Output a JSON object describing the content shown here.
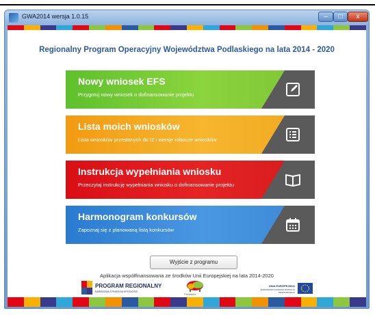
{
  "window": {
    "title": "GWA2014 wersja 1.0.15",
    "controls": {
      "minimize": "–",
      "maximize": "□",
      "close": "x"
    }
  },
  "colors": {
    "stripe": [
      "#e30613",
      "#f9b000",
      "#3a3a8c",
      "#2fa7d8",
      "#e30613",
      "#8dc63f",
      "#f39200",
      "#2c5aa0",
      "#8dc63f",
      "#e30613",
      "#3a3a8c",
      "#f9b000",
      "#2fa7d8",
      "#e30613",
      "#8dc63f",
      "#f39200",
      "#2c5aa0",
      "#e30613",
      "#f9b000",
      "#2fa7d8",
      "#8dc63f",
      "#3a3a8c"
    ],
    "heading": "#2c5aa0",
    "tile_green": "#6ec630",
    "tile_orange": "#f5a623",
    "tile_red": "#e01b1b",
    "tile_blue": "#3a8ad8"
  },
  "heading": "Regionalny Program Operacyjny Województwa Podlaskiego na lata 2014 - 2020",
  "tiles": [
    {
      "title": "Nowy wniosek EFS",
      "subtitle": "Przygotuj nowy wniosek o dofinansowanie projektu",
      "icon": "edit-icon"
    },
    {
      "title": "Lista moich wniosków",
      "subtitle": "Lista wniosków przesłanych do IZ i wersje robocze wniosków",
      "icon": "list-icon"
    },
    {
      "title": "Instrukcja wypełniania wniosku",
      "subtitle": "Przeczytaj instrukcję wypełniania wniosku o dofinansowanie projektu",
      "icon": "book-icon"
    },
    {
      "title": "Harmonogram konkursów",
      "subtitle": "Zapoznaj się z planowaną listą konkursów",
      "icon": "calendar-icon"
    }
  ],
  "exit_button": "Wyjście z programu",
  "cofinancing": "Aplikacja współfinansowana ze środków Unii Europejskiej na lata 2014-2020",
  "logos": {
    "program_regional": {
      "main": "PROGRAM REGIONALNY",
      "sub": "NARODOWA STRATEGIA SPÓJNOŚCI"
    },
    "podlaskie": {
      "name": "Podlaskie"
    },
    "eu": {
      "line1": "UNIA EUROPEJSKA",
      "line2": "EUROPEJSKI FUNDUSZ ROZWOJU REGIONALNEGO"
    }
  }
}
